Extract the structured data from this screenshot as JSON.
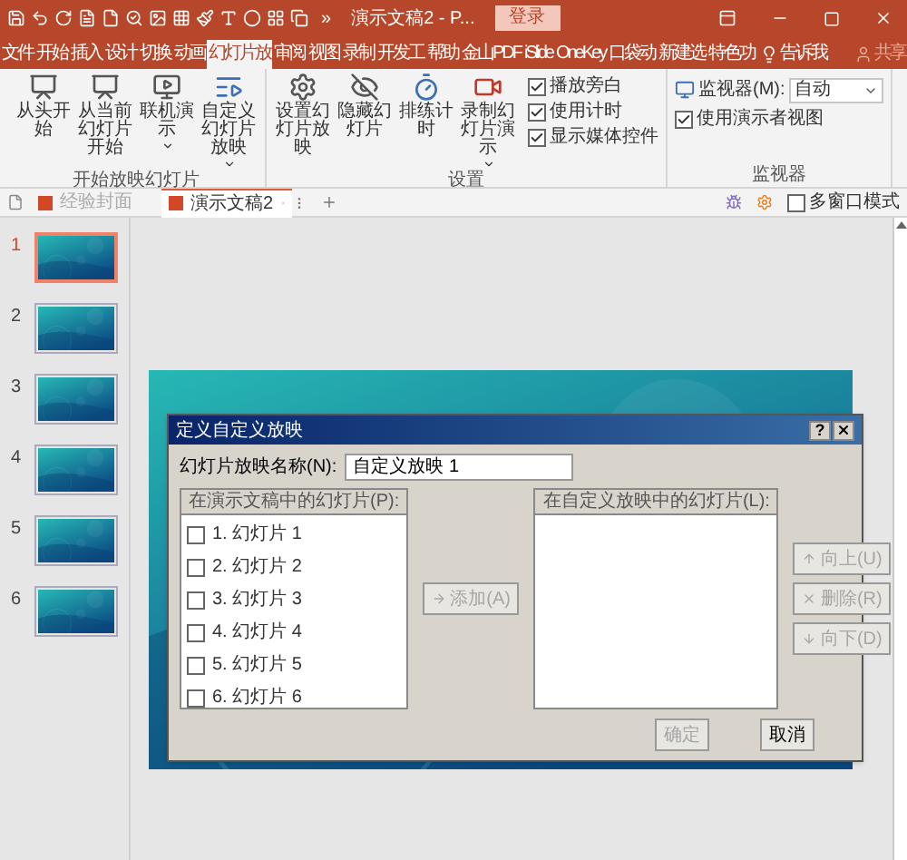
{
  "title_bar": {
    "overflow": "»",
    "title": "演示文稿2 - P...",
    "login": "登录"
  },
  "menu_tabs": [
    {
      "label": "文件",
      "selected": false
    },
    {
      "label": "开始",
      "selected": false
    },
    {
      "label": "插入",
      "selected": false
    },
    {
      "label": "设计",
      "selected": false
    },
    {
      "label": "切换",
      "selected": false
    },
    {
      "label": "动画",
      "selected": false
    },
    {
      "label": "幻灯片放",
      "selected": true
    },
    {
      "label": "审阅",
      "selected": false
    },
    {
      "label": "视图",
      "selected": false
    },
    {
      "label": "录制",
      "selected": false
    },
    {
      "label": "开发工",
      "selected": false
    },
    {
      "label": "帮助",
      "selected": false
    },
    {
      "label": "金山PDF",
      "selected": false
    },
    {
      "label": "iSlide",
      "selected": false
    },
    {
      "label": "OneKey",
      "selected": false
    },
    {
      "label": "口袋动",
      "selected": false
    },
    {
      "label": "新建选",
      "selected": false
    },
    {
      "label": "特色功",
      "selected": false
    }
  ],
  "tell_me": "告诉我",
  "share": "共享",
  "ribbon": {
    "groups": [
      {
        "label": "开始放映幻灯片",
        "buttons": [
          {
            "label": "从头开始",
            "kind": "play",
            "dropdown": false
          },
          {
            "label": "从当前幻灯片开始",
            "kind": "play",
            "dropdown": false
          },
          {
            "label": "联机演示",
            "kind": "online",
            "dropdown": true
          },
          {
            "label": "自定义幻灯片放映",
            "kind": "custom",
            "dropdown": true
          }
        ]
      },
      {
        "label": "设置",
        "buttons": [
          {
            "label": "设置幻灯片放映",
            "kind": "setup",
            "dropdown": false
          },
          {
            "label": "隐藏幻灯片",
            "kind": "hide",
            "dropdown": false
          },
          {
            "label": "排练计时",
            "kind": "timer",
            "dropdown": false
          },
          {
            "label": "录制幻灯片演示",
            "kind": "record",
            "dropdown": true
          }
        ],
        "checkboxes": [
          {
            "label": "播放旁白",
            "checked": true
          },
          {
            "label": "使用计时",
            "checked": true
          },
          {
            "label": "显示媒体控件",
            "checked": true
          }
        ]
      },
      {
        "label": "监视器",
        "monitor_label": "监视器(M):",
        "monitor_value": "自动",
        "checkboxes": [
          {
            "label": "使用演示者视图",
            "checked": true
          }
        ]
      }
    ]
  },
  "doc_tabs": [
    {
      "label": "经验封面",
      "selected": false
    },
    {
      "label": "演示文稿2",
      "selected": true
    }
  ],
  "multi_window": {
    "label": "多窗口模式",
    "checked": false
  },
  "slides": [
    {
      "number": "1",
      "selected": true
    },
    {
      "number": "2",
      "selected": false
    },
    {
      "number": "3",
      "selected": false
    },
    {
      "number": "4",
      "selected": false
    },
    {
      "number": "5",
      "selected": false
    },
    {
      "number": "6",
      "selected": false
    }
  ],
  "dialog": {
    "title": "定义自定义放映",
    "help": "?",
    "name_label": "幻灯片放映名称(N):",
    "name_value": "自定义放映 1",
    "left_header": "在演示文稿中的幻灯片(P):",
    "left_items": [
      {
        "label": "1. 幻灯片 1",
        "checked": false
      },
      {
        "label": "2. 幻灯片 2",
        "checked": false
      },
      {
        "label": "3. 幻灯片 3",
        "checked": false
      },
      {
        "label": "4. 幻灯片 4",
        "checked": false
      },
      {
        "label": "5. 幻灯片 5",
        "checked": false
      },
      {
        "label": "6. 幻灯片 6",
        "checked": false
      }
    ],
    "add_button": {
      "label": "添加(A)",
      "disabled": true
    },
    "right_header": "在自定义放映中的幻灯片(L):",
    "side_buttons": [
      {
        "label": "向上(U)",
        "kind": "up",
        "disabled": true
      },
      {
        "label": "删除(R)",
        "kind": "delete",
        "disabled": true
      },
      {
        "label": "向下(D)",
        "kind": "down",
        "disabled": true
      }
    ],
    "ok_button": {
      "label": "确定",
      "disabled": true
    },
    "cancel_button": {
      "label": "取消",
      "disabled": false
    }
  }
}
